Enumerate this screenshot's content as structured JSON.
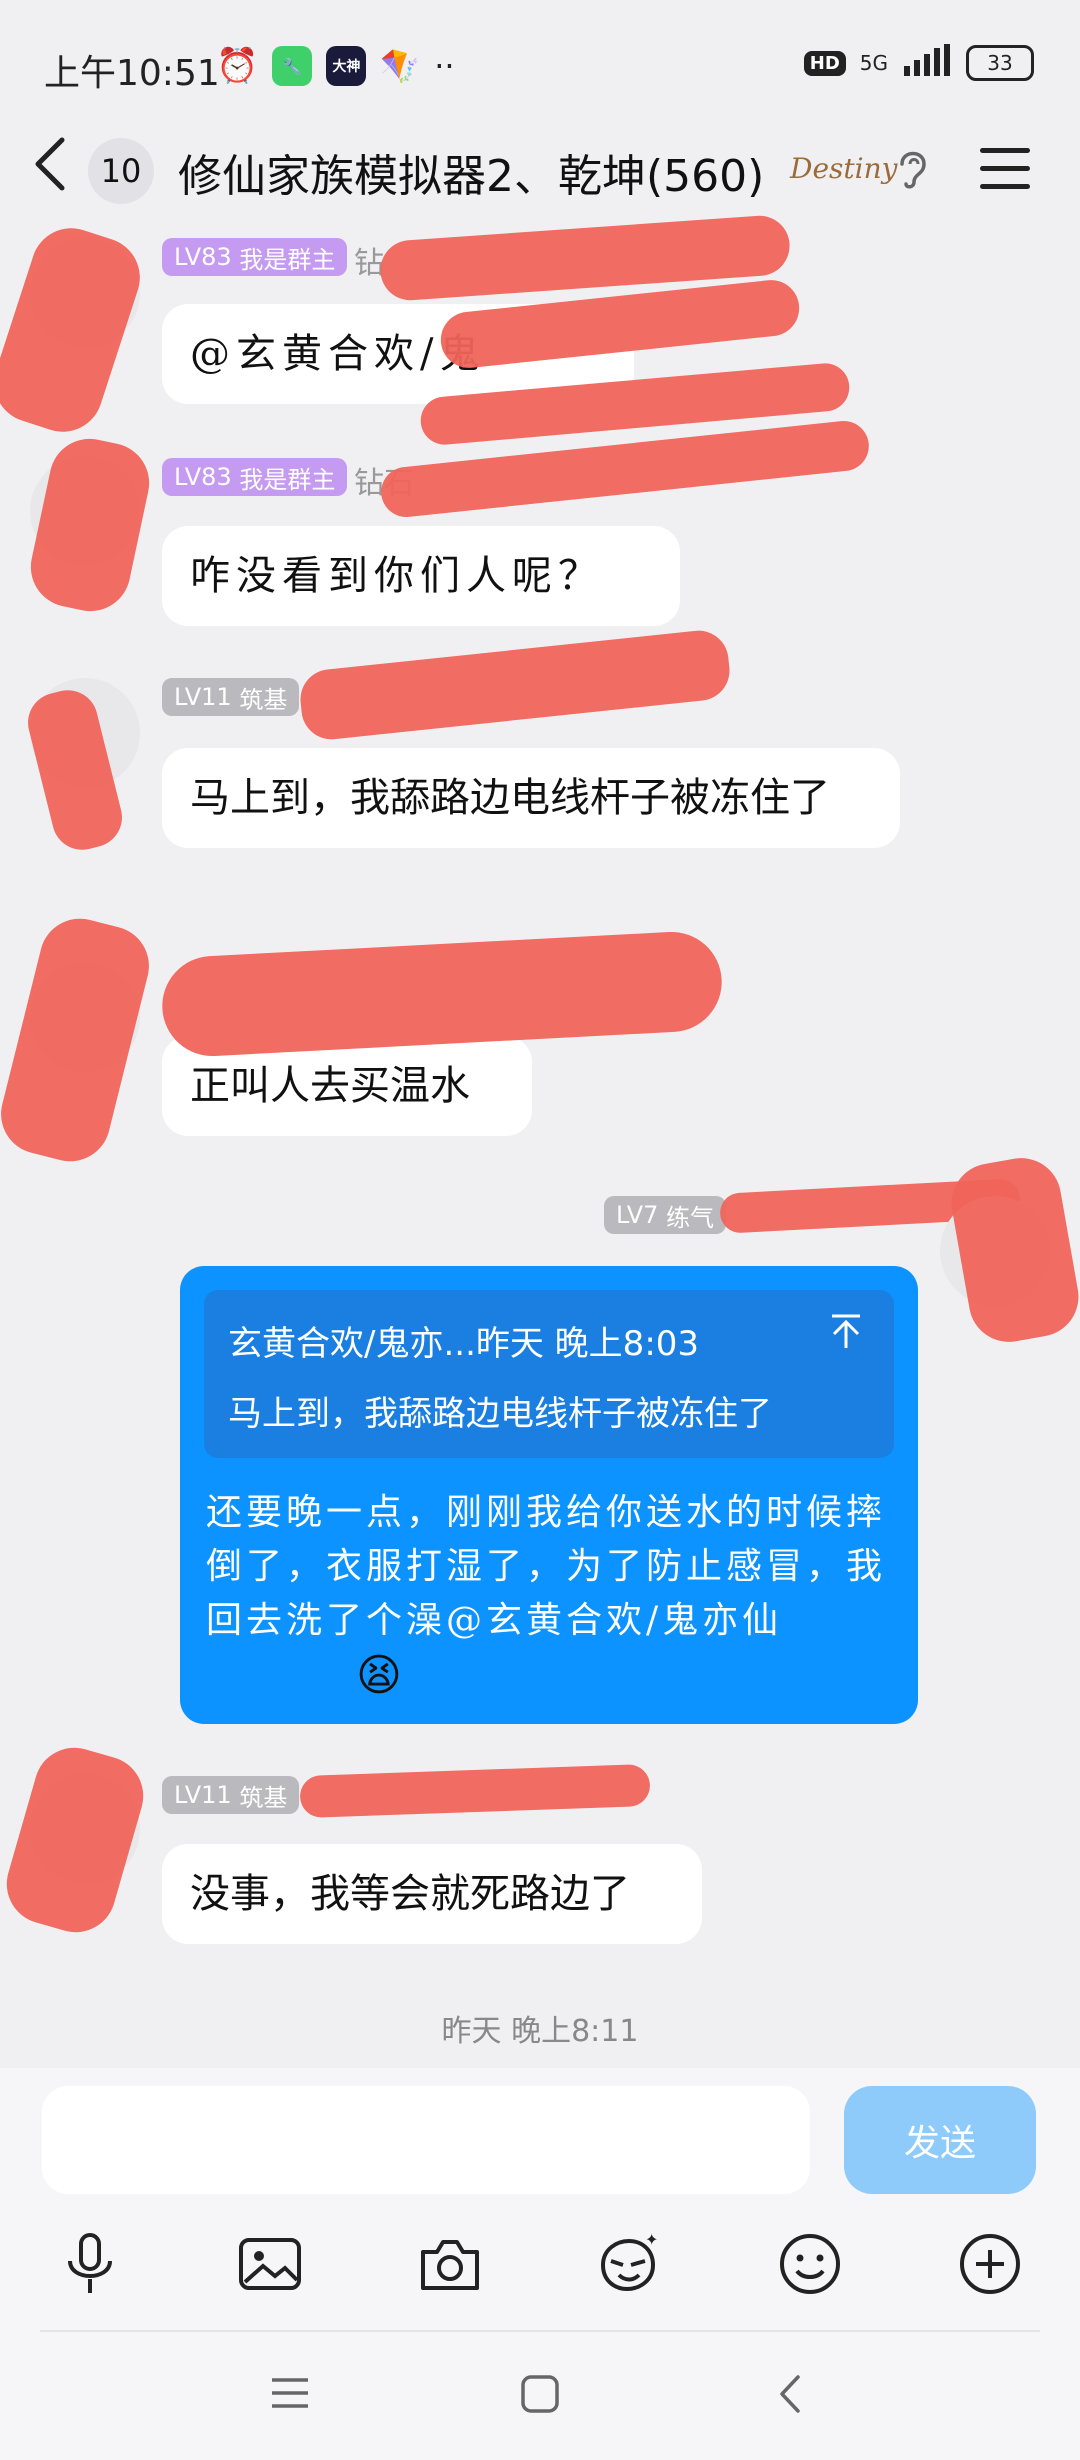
{
  "status_bar": {
    "time": "上午10:51",
    "app_badge": "大神",
    "network": "5G",
    "hd": "HD",
    "battery": "33"
  },
  "header": {
    "unread_count": "10",
    "title": "修仙家族模拟器2、乾坤(560)"
  },
  "messages": [
    {
      "level": "LV83",
      "role": "我是群主",
      "name_visible": "钻",
      "text": "@玄黄合欢/鬼",
      "handwritten": true
    },
    {
      "level": "LV83",
      "role": "我是群主",
      "name_visible": "钻石",
      "text": "咋没看到你们人呢？",
      "handwritten": true
    },
    {
      "level": "LV11",
      "role": "筑基",
      "text": "马上到，我舔路边电线杆子被冻住了",
      "handwritten": false
    },
    {
      "text": "正叫人去买温水",
      "handwritten": false
    },
    {
      "level": "LV7",
      "role": "练气",
      "own": true,
      "quote_header": "玄黄合欢/鬼亦...昨天 晚上8:03",
      "quote_text": "马上到，我舔路边电线杆子被冻住了",
      "text": "还要晚一点，刚刚我给你送水的时候摔倒了，衣服打湿了，为了防止感冒，我回去洗了个澡@玄黄合欢/鬼亦仙"
    },
    {
      "level": "LV11",
      "role": "筑基",
      "text": "没事，我等会就死路边了",
      "handwritten": false
    }
  ],
  "timestamp": "昨天 晚上8:11",
  "input": {
    "send_label": "发送"
  },
  "colors": {
    "accent": "#0c93ff",
    "redaction": "#f0645a",
    "owner_badge": "#c49bf0"
  },
  "icons": [
    "microphone-icon",
    "image-icon",
    "camera-icon",
    "sticker-icon",
    "emoji-icon",
    "plus-icon"
  ]
}
